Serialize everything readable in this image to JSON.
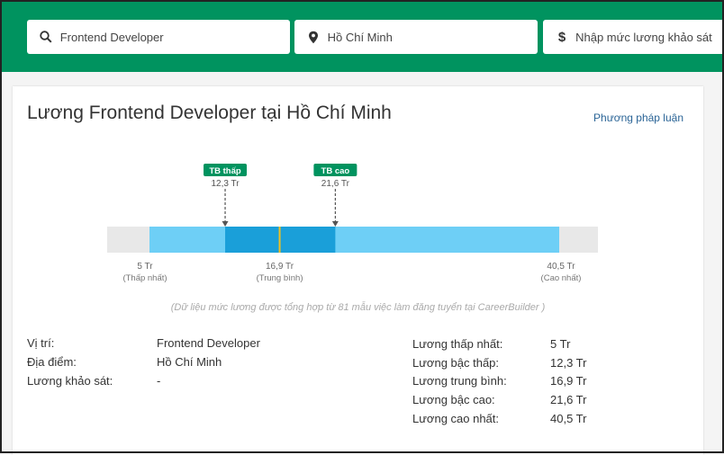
{
  "search": {
    "job": "Frontend Developer",
    "location": "Hồ Chí Minh",
    "salary_placeholder": "Nhập mức lương khảo sát"
  },
  "page": {
    "title": "Lương Frontend Developer tại Hồ Chí Minh",
    "methodology_link": "Phương pháp luận",
    "source_note": "(Dữ liệu mức lương được tổng hợp từ 81 mẫu việc làm đăng tuyển tại CareerBuilder )"
  },
  "chart_data": {
    "type": "range",
    "unit": "Tr",
    "min": 5,
    "low": 12.3,
    "median": 16.9,
    "high": 21.6,
    "max": 40.5,
    "min_label": "5 Tr",
    "min_caption": "(Thấp nhất)",
    "low_badge": "TB thấp",
    "low_label": "12,3 Tr",
    "median_label": "16,9 Tr",
    "median_caption": "(Trung bình)",
    "high_badge": "TB cao",
    "high_label": "21,6 Tr",
    "max_label": "40,5 Tr",
    "max_caption": "(Cao nhất)",
    "colors": {
      "range": "#6ecff6",
      "mid": "#1a9fd9",
      "median": "#f0c020",
      "track": "#e8e8e8",
      "badge": "#00935f"
    }
  },
  "details": {
    "left": [
      {
        "label": "Vị trí:",
        "value": "Frontend Developer"
      },
      {
        "label": "Địa điểm:",
        "value": "Hồ Chí Minh"
      },
      {
        "label": "Lương khảo sát:",
        "value": "-"
      }
    ],
    "right": [
      {
        "label": "Lương thấp nhất:",
        "value": "5 Tr"
      },
      {
        "label": "Lương bậc thấp:",
        "value": "12,3 Tr"
      },
      {
        "label": "Lương trung bình:",
        "value": "16,9 Tr"
      },
      {
        "label": "Lương bậc cao:",
        "value": "21,6 Tr"
      },
      {
        "label": "Lương cao nhất:",
        "value": "40,5 Tr"
      }
    ]
  }
}
